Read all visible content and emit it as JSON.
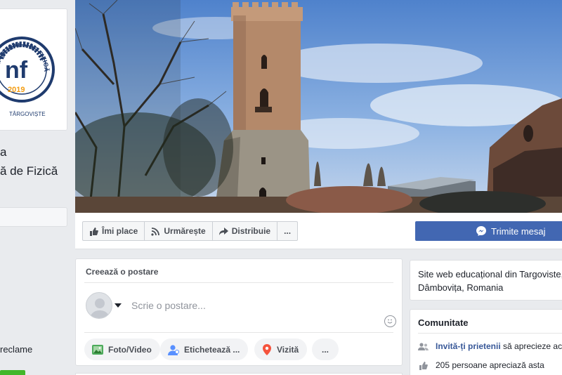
{
  "sidebar": {
    "logo": {
      "ring_text": "NAȚIONALĂ DE FIZICĂ",
      "monogram": "nf",
      "year": "2019",
      "city": "TÂRGOVIȘTE"
    },
    "page_name_line1": "a",
    "page_name_line2": "ă de Fizică",
    "ads_label": "reclame"
  },
  "actions": {
    "like": "Îmi place",
    "follow": "Urmărește",
    "share": "Distribuie",
    "more": "...",
    "message": "Trimite mesaj"
  },
  "composer": {
    "title": "Creează o postare",
    "placeholder": "Scrie o postare...",
    "buttons": {
      "photo": "Foto/Video",
      "tag": "Etichetează ...",
      "checkin": "Vizită",
      "more": "..."
    }
  },
  "about": {
    "line1": "Site web educațional din Targoviste,",
    "line2": "Dâmbovița, Romania"
  },
  "community": {
    "title": "Comunitate",
    "invite_link": "Invită-ți prietenii",
    "invite_rest": "să aprecieze acea",
    "likes_text": "205 persoane apreciază asta"
  },
  "colors": {
    "brand_blue": "#4267b2",
    "link_blue": "#385898",
    "page_bg": "#e9ebee",
    "sky": "#6f9cd6",
    "tower": "#b48a6a"
  }
}
